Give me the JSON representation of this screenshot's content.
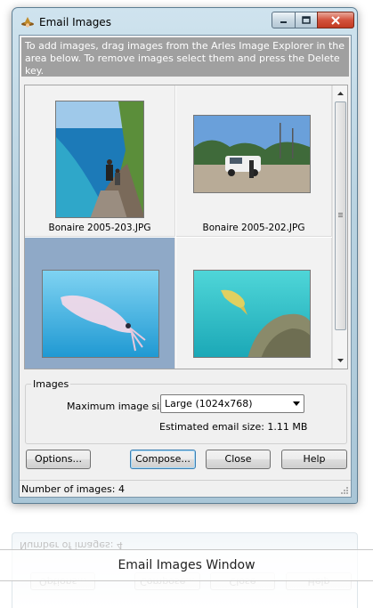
{
  "window": {
    "title": "Email Images",
    "app_icon": "wizard-hat-icon",
    "controls": [
      "minimize-icon",
      "maximize-icon",
      "close-icon"
    ]
  },
  "banner": {
    "text": "To add images, drag images from the Arles Image Explorer in the area below. To remove images select them and press the Delete key."
  },
  "gallery": {
    "items": [
      {
        "caption": "Bonaire 2005-203.JPG",
        "selected": false
      },
      {
        "caption": "Bonaire 2005-202.JPG",
        "selected": false
      },
      {
        "caption": "",
        "selected": true
      },
      {
        "caption": "",
        "selected": false
      }
    ]
  },
  "images_group": {
    "label": "Images",
    "max_size_label": "Maximum image size:",
    "max_size_value": "Large (1024x768)",
    "estimated_size_text": "Estimated email size:  1.11 MB"
  },
  "buttons": {
    "options": "Options...",
    "compose": "Compose...",
    "close": "Close",
    "help": "Help"
  },
  "status": {
    "text": "Number of images: 4"
  },
  "caption": {
    "text": "Email Images Window"
  },
  "colors": {
    "selection": "#8fa9c7",
    "banner": "#a0a0a0",
    "close_button": "#c8442b"
  }
}
